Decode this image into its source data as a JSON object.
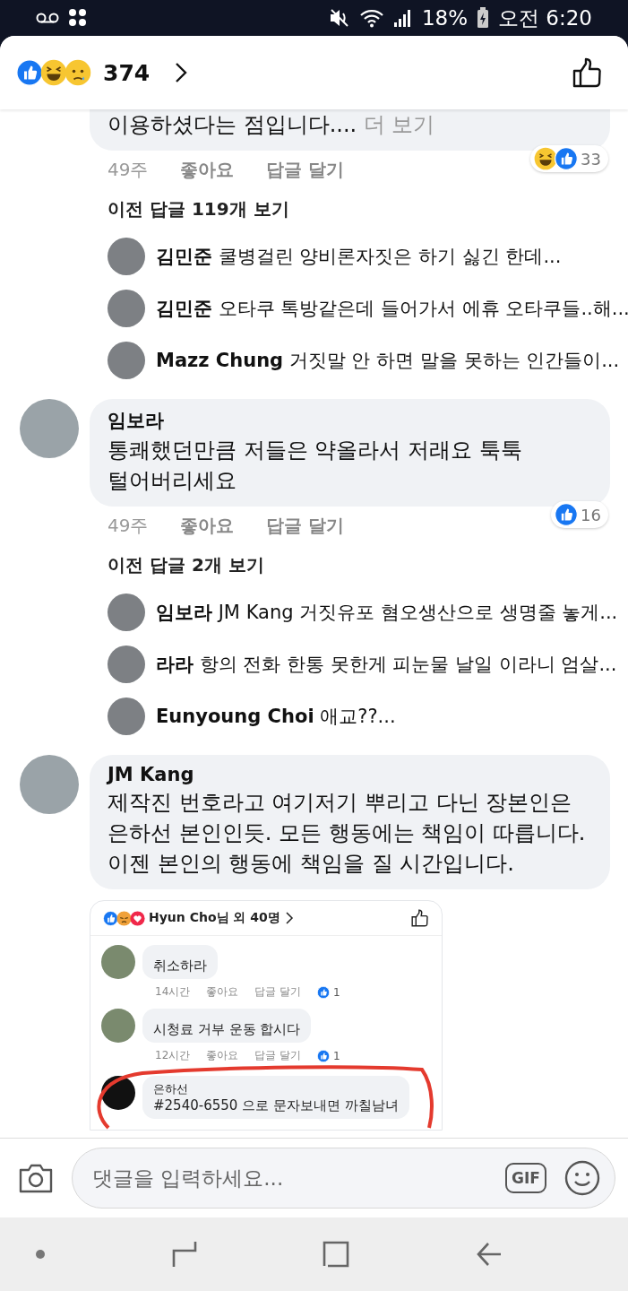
{
  "status_bar": {
    "battery": "18%",
    "time": "오전 6:20"
  },
  "header": {
    "reactions": [
      {
        "kind": "like"
      },
      {
        "kind": "haha"
      },
      {
        "kind": "sad"
      }
    ],
    "count": "374"
  },
  "comments": [
    {
      "lines": [
        "이용하셨다는 점입니다...."
      ],
      "more": "더 보기",
      "age": "49주",
      "like": "좋아요",
      "reply": "답글 달기",
      "reactions": [
        {
          "kind": "haha"
        },
        {
          "kind": "like"
        }
      ],
      "reaction_count": "33",
      "previous_replies": "이전 답글 119개 보기",
      "replies": [
        {
          "name": "김민준",
          "text": "쿨병걸린 양비론자짓은 하기 싫긴 한데..."
        },
        {
          "name": "김민준",
          "text": "오타쿠 톡방같은데 들어가서 에휴 오타쿠들..해..."
        },
        {
          "name": "Mazz Chung",
          "text": "거짓말 안 하면 말을 못하는 인간들이..."
        }
      ]
    },
    {
      "name": "임보라",
      "lines": [
        "통쾌했던만큼 저들은 약올라서 저래요 툭툭",
        "털어버리세요"
      ],
      "age": "49주",
      "like": "좋아요",
      "reply": "답글 달기",
      "reactions": [
        {
          "kind": "like"
        }
      ],
      "reaction_count": "16",
      "previous_replies": "이전 답글 2개 보기",
      "replies": [
        {
          "name": "임보라",
          "text": "JM Kang 거짓유포 혐오생산으로 생명줄 놓게..."
        },
        {
          "name": "라라",
          "text": "항의 전화 한통 못한게 피눈물  날일 이라니 엄살..."
        },
        {
          "name": "Eunyoung Choi",
          "text": "애교??..."
        }
      ]
    },
    {
      "name": "JM Kang",
      "lines": [
        "제작진 번호라고 여기저기 뿌리고 다닌 장본인은",
        "은하선 본인인듯. 모든 행동에는 책임이 따릅니다.",
        "이젠 본인의 행동에 책임을 질 시간입니다."
      ],
      "attachment": {
        "reactions": [
          {
            "kind": "like"
          },
          {
            "kind": "angry"
          },
          {
            "kind": "love"
          }
        ],
        "title": "Hyun Cho님 외 40명",
        "comments": [
          {
            "text": "취소하라",
            "age": "14시간",
            "like": "좋아요",
            "reply": "답글 달기",
            "like_count": "1"
          },
          {
            "text": "시청료 거부 운동 합시다",
            "age": "12시간",
            "like": "좋아요",
            "reply": "답글 달기",
            "like_count": "1"
          },
          {
            "name": "은하선",
            "text": "#2540-6550 으로 문자보내면 까칠남녀"
          }
        ]
      }
    }
  ],
  "composer": {
    "placeholder": "댓글을 입력하세요...",
    "gif": "GIF"
  }
}
